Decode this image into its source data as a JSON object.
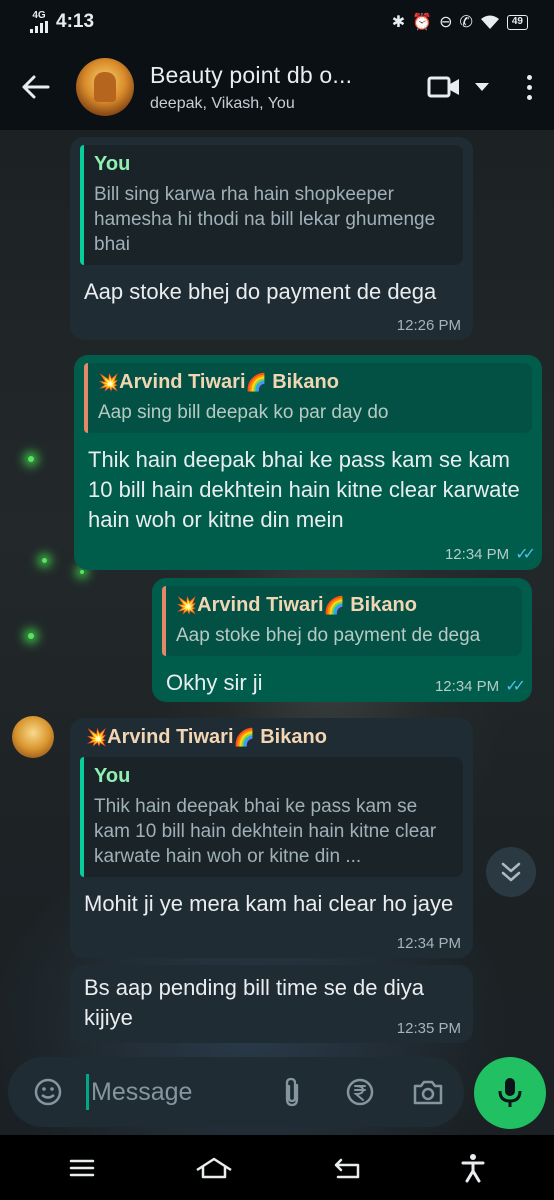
{
  "status_bar": {
    "network": "4G",
    "time": "4:13",
    "battery": "49"
  },
  "header": {
    "title": "Beauty point db o...",
    "subtitle": "deepak, Vikash, You"
  },
  "messages": [
    {
      "direction": "incoming",
      "quote_author": "You",
      "quote_text": "Bill sing karwa rha hain shopkeeper hamesha hi thodi na bill lekar ghumenge bhai",
      "text": "Aap stoke bhej do payment de dega",
      "time": "12:26 PM"
    },
    {
      "direction": "outgoing",
      "quote_author_prefix": "💥",
      "quote_author": "Arvind Tiwari",
      "quote_author_emoji": "🌈",
      "quote_author_suffix": "Bikano",
      "quote_text": "Aap sing bill deepak ko par day do",
      "text": "Thik hain deepak bhai ke pass kam se kam 10 bill hain dekhtein hain kitne clear karwate hain woh or kitne din mein",
      "time": "12:34 PM"
    },
    {
      "direction": "outgoing",
      "quote_author_prefix": "💥",
      "quote_author": "Arvind Tiwari",
      "quote_author_emoji": "🌈",
      "quote_author_suffix": "Bikano",
      "quote_text": "Aap stoke bhej do payment de dega",
      "text": "Okhy sir ji",
      "time": "12:34 PM"
    },
    {
      "direction": "incoming",
      "sender_prefix": "💥",
      "sender": "Arvind Tiwari",
      "sender_emoji": "🌈",
      "sender_suffix": "Bikano",
      "quote_author": "You",
      "quote_text": "Thik hain deepak bhai ke pass kam se kam 10 bill hain dekhtein hain kitne clear karwate hain woh or kitne din ...",
      "text": "Mohit ji ye mera kam hai clear ho jaye",
      "time": "12:34 PM"
    },
    {
      "direction": "incoming",
      "text": "Bs aap pending bill time se de diya kijiye",
      "time": "12:35 PM"
    }
  ],
  "composer": {
    "placeholder": "Message"
  },
  "icons": {
    "back": "arrow-left-icon",
    "video": "video-camera-icon",
    "dropdown": "caret-down-icon",
    "menu": "more-vertical-icon",
    "sticker": "sticker-icon",
    "attach": "paperclip-icon",
    "payment": "rupee-icon",
    "camera": "camera-icon",
    "mic": "microphone-icon",
    "scroll": "double-chevron-down-icon"
  },
  "colors": {
    "incoming_bubble": "#202c33",
    "outgoing_bubble": "#005c4b",
    "accent_green": "#21c063",
    "read_ticks": "#53bdeb"
  }
}
